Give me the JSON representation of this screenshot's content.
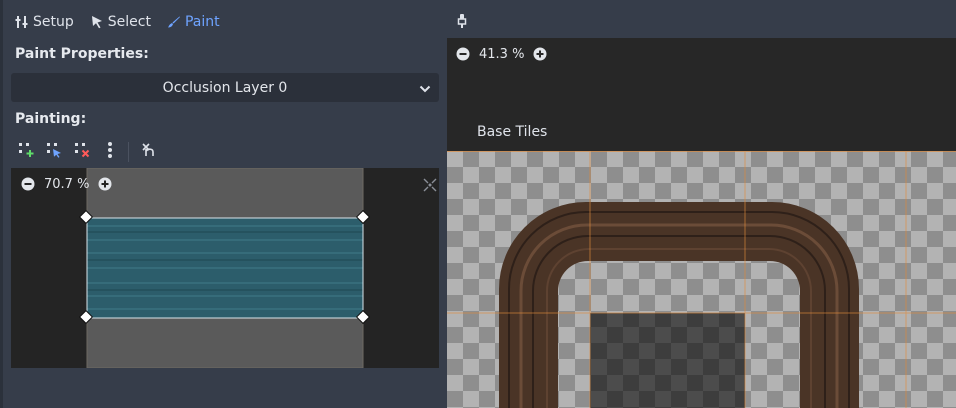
{
  "tabs": [
    {
      "label": "Setup",
      "icon": "setup-icon"
    },
    {
      "label": "Select",
      "icon": "select-cursor-icon"
    },
    {
      "label": "Paint",
      "icon": "paint-brush-icon",
      "active": true
    }
  ],
  "paint_properties": {
    "label": "Paint Properties:",
    "selected_option": "Occlusion Layer 0"
  },
  "painting": {
    "label": "Painting:",
    "tools": [
      "add-polygon-icon",
      "edit-polygon-icon",
      "delete-polygon-icon",
      "more-options-icon",
      "clear-polygon-icon"
    ]
  },
  "tile_editor": {
    "zoom": "70.7 %"
  },
  "atlas": {
    "zoom": "41.3 %",
    "source_label": "Base Tiles"
  },
  "colors": {
    "accent": "#6ea3ff",
    "panel": "#363d4a",
    "dark": "#242424",
    "tile": "#2c5d6b",
    "road": "#4a3426"
  }
}
